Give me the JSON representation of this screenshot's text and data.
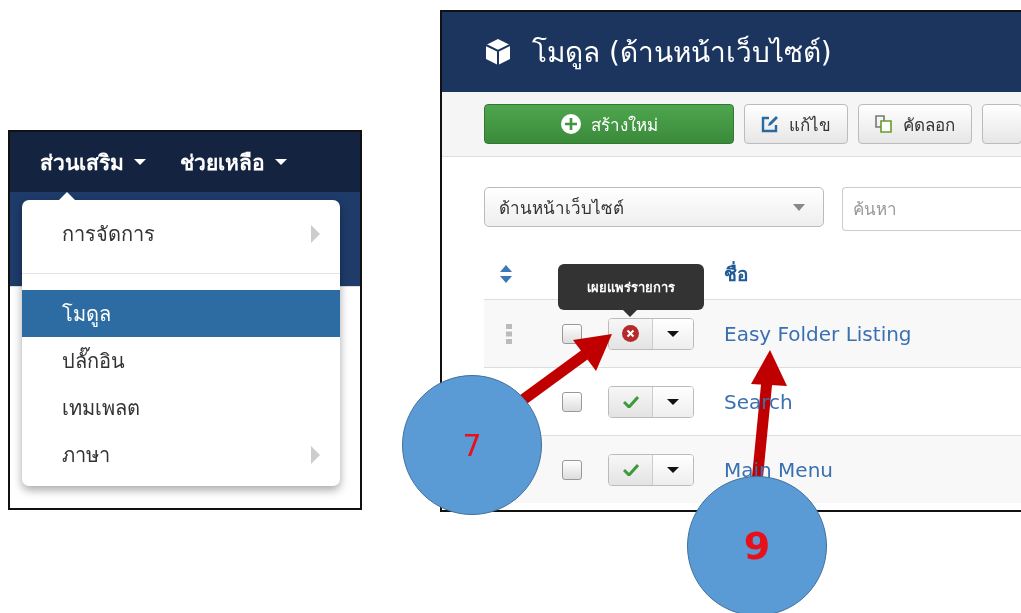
{
  "extensions_screen": {
    "nav": [
      {
        "label": "ส่วนเสริม"
      },
      {
        "label": "ช่วยเหลือ"
      }
    ],
    "dropdown": [
      {
        "kind": "item",
        "label": "การจัดการ",
        "submenu": true,
        "selected": false
      },
      {
        "kind": "divider"
      },
      {
        "kind": "item",
        "label": "โมดูล",
        "submenu": false,
        "selected": true
      },
      {
        "kind": "item",
        "label": "ปลั๊กอิน",
        "submenu": false,
        "selected": false
      },
      {
        "kind": "item",
        "label": "เทมเพลต",
        "submenu": false,
        "selected": false
      },
      {
        "kind": "item",
        "label": "ภาษา",
        "submenu": true,
        "selected": false
      }
    ]
  },
  "modules_screen": {
    "title": "โมดูล (ด้านหน้าเว็บไซต์)",
    "toolbar": [
      {
        "kind": "new",
        "label": "สร้างใหม่"
      },
      {
        "kind": "edit",
        "label": "แก้ไข"
      },
      {
        "kind": "copy",
        "label": "คัดลอก"
      },
      {
        "kind": "partial"
      }
    ],
    "filter": {
      "value": "ด้านหน้าเว็บไซต์"
    },
    "search": {
      "placeholder": "ค้นหา"
    },
    "columns": [
      "ชื่อ"
    ],
    "tooltip": "เผยแพร่รายการ",
    "rows": [
      {
        "title": "Easy Folder Listing",
        "published": false,
        "checked": false
      },
      {
        "title": "Search",
        "published": true,
        "checked": false
      },
      {
        "title": "Main Menu",
        "published": true,
        "checked": false
      }
    ]
  },
  "callouts": [
    {
      "number": "7"
    },
    {
      "number": "9"
    }
  ]
}
